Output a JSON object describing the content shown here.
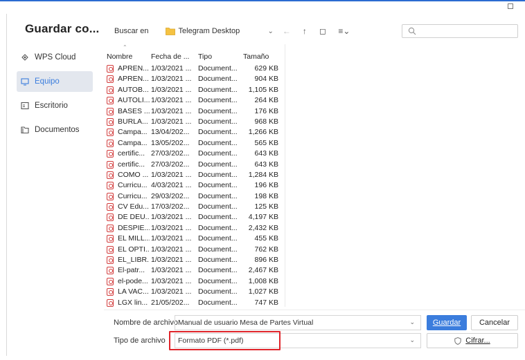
{
  "dialog": {
    "title": "Guardar co..."
  },
  "sidebar": {
    "items": [
      {
        "label": "WPS Cloud",
        "icon": "cloud-icon",
        "active": false
      },
      {
        "label": "Equipo",
        "icon": "monitor-icon",
        "active": true
      },
      {
        "label": "Escritorio",
        "icon": "desktop-icon",
        "active": false
      },
      {
        "label": "Documentos",
        "icon": "folder-icon",
        "active": false
      }
    ]
  },
  "location": {
    "label": "Buscar en",
    "folder": "Telegram Desktop",
    "icons": [
      "chevron-down-icon",
      "back-arrow-icon",
      "up-arrow-icon",
      "new-folder-icon",
      "view-menu-icon"
    ]
  },
  "search": {
    "placeholder": ""
  },
  "columns": {
    "name": "Nombre",
    "date": "Fecha de ...",
    "type": "Tipo",
    "size": "Tamaño"
  },
  "files": [
    {
      "name": "APREN...",
      "date": "1/03/2021 ...",
      "type": "Document...",
      "size": "629 KB"
    },
    {
      "name": "APREN...",
      "date": "1/03/2021 ...",
      "type": "Document...",
      "size": "904 KB"
    },
    {
      "name": "AUTOB...",
      "date": "1/03/2021 ...",
      "type": "Document...",
      "size": "1,105 KB"
    },
    {
      "name": "AUTOLI...",
      "date": "1/03/2021 ...",
      "type": "Document...",
      "size": "264 KB"
    },
    {
      "name": "BASES ...",
      "date": "1/03/2021 ...",
      "type": "Document...",
      "size": "176 KB"
    },
    {
      "name": "BURLA...",
      "date": "1/03/2021 ...",
      "type": "Document...",
      "size": "968 KB"
    },
    {
      "name": "Campa...",
      "date": "13/04/202...",
      "type": "Document...",
      "size": "1,266 KB"
    },
    {
      "name": "Campa...",
      "date": "13/05/202...",
      "type": "Document...",
      "size": "565 KB"
    },
    {
      "name": "certific...",
      "date": "27/03/202...",
      "type": "Document...",
      "size": "643 KB"
    },
    {
      "name": "certific...",
      "date": "27/03/202...",
      "type": "Document...",
      "size": "643 KB"
    },
    {
      "name": "COMO ...",
      "date": "1/03/2021 ...",
      "type": "Document...",
      "size": "1,284 KB"
    },
    {
      "name": "Curricu...",
      "date": "4/03/2021 ...",
      "type": "Document...",
      "size": "196 KB"
    },
    {
      "name": "Curricu...",
      "date": "29/03/202...",
      "type": "Document...",
      "size": "198 KB"
    },
    {
      "name": "CV Edu...",
      "date": "17/03/202...",
      "type": "Document...",
      "size": "125 KB"
    },
    {
      "name": "DE DEU...",
      "date": "1/03/2021 ...",
      "type": "Document...",
      "size": "4,197 KB"
    },
    {
      "name": "DESPIE...",
      "date": "1/03/2021 ...",
      "type": "Document...",
      "size": "2,432 KB"
    },
    {
      "name": "EL MILL...",
      "date": "1/03/2021 ...",
      "type": "Document...",
      "size": "455 KB"
    },
    {
      "name": "EL OPTI...",
      "date": "1/03/2021 ...",
      "type": "Document...",
      "size": "762 KB"
    },
    {
      "name": "EL_LIBR...",
      "date": "1/03/2021 ...",
      "type": "Document...",
      "size": "896 KB"
    },
    {
      "name": "El-patr...",
      "date": "1/03/2021 ...",
      "type": "Document...",
      "size": "2,467 KB"
    },
    {
      "name": "el-pode...",
      "date": "1/03/2021 ...",
      "type": "Document...",
      "size": "1,008 KB"
    },
    {
      "name": "LA VAC...",
      "date": "1/03/2021 ...",
      "type": "Document...",
      "size": "1,027 KB"
    },
    {
      "name": "LGX lin...",
      "date": "21/05/202...",
      "type": "Document...",
      "size": "747 KB"
    }
  ],
  "filename": {
    "label": "Nombre de archivo",
    "value": "Manual de usuario Mesa de Partes Virtual"
  },
  "filetype": {
    "label": "Tipo de archivo",
    "value": "Formato PDF (*.pdf)"
  },
  "buttons": {
    "save": "Guardar",
    "cancel": "Cancelar",
    "encrypt": "Cifrar..."
  },
  "colors": {
    "accent": "#3b7ddd",
    "highlight": "#e0242a",
    "pdf": "#d23b3b"
  }
}
